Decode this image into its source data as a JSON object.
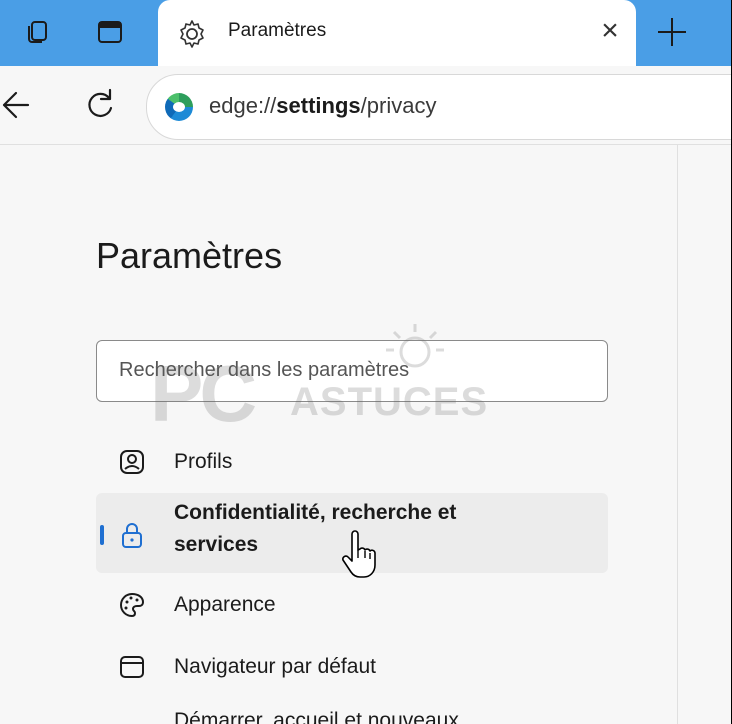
{
  "browser": {
    "tab": {
      "title": "Paramètres",
      "close_label": "×"
    },
    "address": {
      "prefix": "edge://",
      "bold": "settings",
      "suffix": "/privacy"
    }
  },
  "page": {
    "title": "Paramètres",
    "search": {
      "placeholder": "Rechercher dans les paramètres"
    },
    "nav": [
      {
        "label": "Profils",
        "icon": "profile-icon"
      },
      {
        "label_line1": "Confidentialité, recherche et",
        "label_line2": "services",
        "icon": "lock-icon",
        "active": true
      },
      {
        "label": "Apparence",
        "icon": "palette-icon"
      },
      {
        "label": "Navigateur par défaut",
        "icon": "browser-window-icon"
      },
      {
        "label": "Démarrer, accueil et nouveaux",
        "icon": "home-icon"
      }
    ]
  },
  "watermark": {
    "text_large": "PC",
    "text_small": "ASTUCES"
  },
  "colors": {
    "tabstrip": "#4a9ee6",
    "accent": "#1f6fd1",
    "sidebar_bg": "#f7f7f7"
  }
}
